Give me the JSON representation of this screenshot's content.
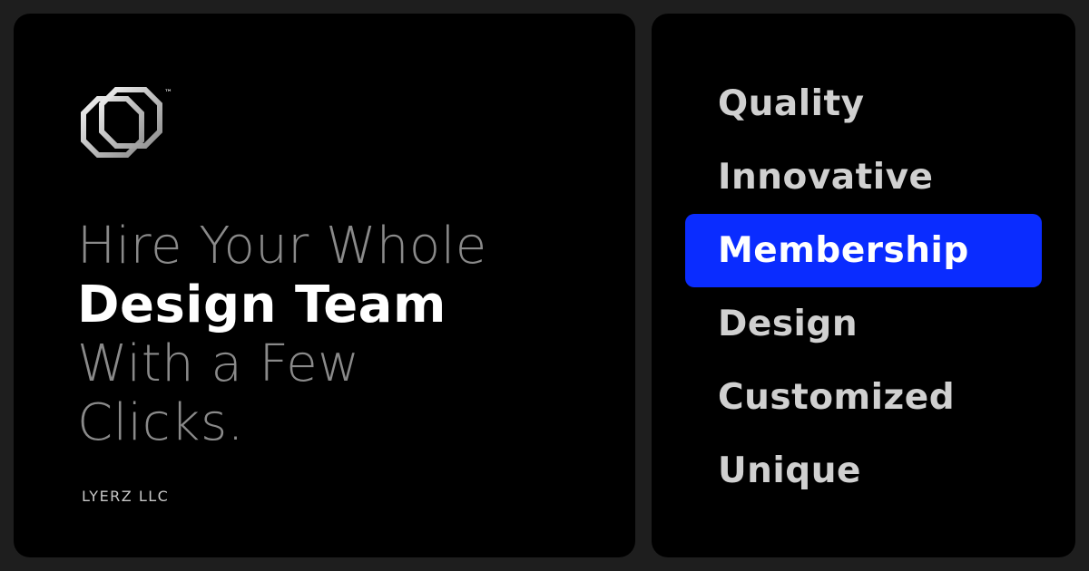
{
  "brand": {
    "logo_icon": "lyerz-logo-icon",
    "trademark": "™",
    "company": "LYERZ LLC"
  },
  "headline": {
    "line1": "Hire Your Whole",
    "line2": "Design Team",
    "line3": "With a Few",
    "line4": "Clicks."
  },
  "values": {
    "items": [
      {
        "label": "Quality"
      },
      {
        "label": "Innovative"
      },
      {
        "label": "Membership"
      },
      {
        "label": "Design"
      },
      {
        "label": "Customized"
      },
      {
        "label": "Unique"
      }
    ],
    "selected": "Membership"
  },
  "colors": {
    "page_background": "#1e1e1e",
    "card_background": "#000000",
    "accent": "#0a2cff",
    "headline_light": "#8a8a8a",
    "headline_bold": "#ffffff",
    "value_text": "#d0d0d0"
  }
}
